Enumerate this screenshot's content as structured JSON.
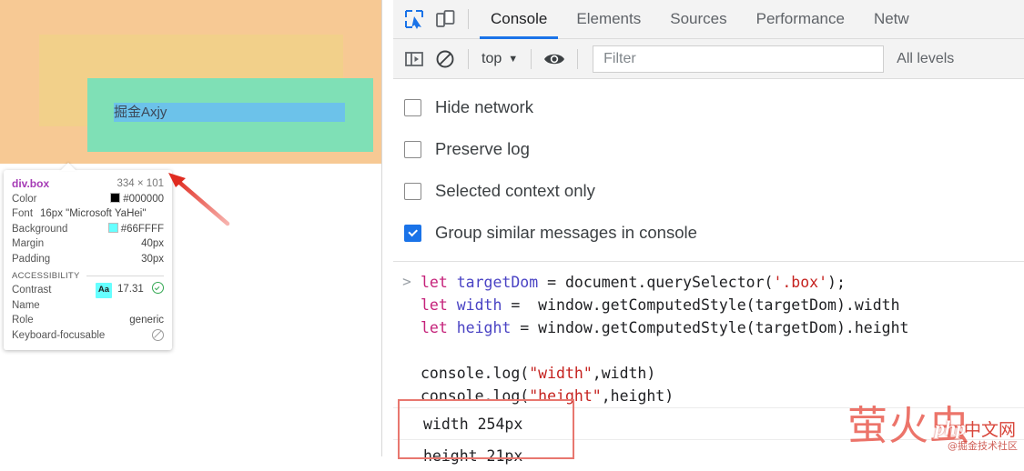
{
  "page": {
    "inline_text": "掘金Axjy",
    "colors": {
      "margin": "#f7c994",
      "padding": "#f2d08a",
      "content": "#7fe0b6",
      "inline": "#6cc2ea"
    }
  },
  "inspect_tooltip": {
    "selector": "div.box",
    "dimensions": "334 × 101",
    "rows": [
      {
        "label": "Color",
        "value": "#000000",
        "swatch": "#000000"
      },
      {
        "label": "Background",
        "value": "#66FFFF",
        "swatch": "#66FFFF"
      },
      {
        "label": "Margin",
        "value": "40px"
      },
      {
        "label": "Padding",
        "value": "30px"
      }
    ],
    "font_label": "Font",
    "font_value": "16px \"Microsoft YaHei\"",
    "color_label": "Color",
    "color_value": "#000000",
    "background_label": "Background",
    "background_value": "#66FFFF",
    "margin_label": "Margin",
    "margin_value": "40px",
    "padding_label": "Padding",
    "padding_value": "30px",
    "accessibility_header": "ACCESSIBILITY",
    "contrast_label": "Contrast",
    "contrast_chip": "Aa",
    "contrast_value": "17.31",
    "name_label": "Name",
    "name_value": "",
    "role_label": "Role",
    "role_value": "generic",
    "keyboard_label": "Keyboard-focusable",
    "keyboard_value": ""
  },
  "devtools": {
    "icons": {
      "inspect": "inspect-element-icon",
      "device": "device-toolbar-icon",
      "sidebar": "console-sidebar-icon",
      "clear": "clear-console-icon",
      "eye": "live-expression-icon"
    },
    "tabs": [
      {
        "label": "Console",
        "active": true
      },
      {
        "label": "Elements",
        "active": false
      },
      {
        "label": "Sources",
        "active": false
      },
      {
        "label": "Performance",
        "active": false
      },
      {
        "label": "Netw",
        "active": false
      }
    ],
    "toolbar": {
      "context": "top",
      "caret": "▼",
      "filter_placeholder": "Filter",
      "filter_value": "",
      "levels": "All levels"
    },
    "settings": [
      {
        "label": "Hide network",
        "checked": false
      },
      {
        "label": "Preserve log",
        "checked": false
      },
      {
        "label": "Selected context only",
        "checked": false
      },
      {
        "label": "Group similar messages in console",
        "checked": true
      }
    ],
    "console": {
      "prompt": ">",
      "code": [
        [
          {
            "t": "let ",
            "c": "kw"
          },
          {
            "t": "targetDom",
            "c": "var"
          },
          {
            "t": " = document.querySelector(",
            "c": "plain"
          },
          {
            "t": "'.box'",
            "c": "str"
          },
          {
            "t": ");",
            "c": "plain"
          }
        ],
        [
          {
            "t": "let ",
            "c": "kw"
          },
          {
            "t": "width",
            "c": "var"
          },
          {
            "t": " =  window.getComputedStyle(targetDom).width",
            "c": "plain"
          }
        ],
        [
          {
            "t": "let ",
            "c": "kw"
          },
          {
            "t": "height",
            "c": "var"
          },
          {
            "t": " = window.getComputedStyle(targetDom).height",
            "c": "plain"
          }
        ],
        [
          {
            "t": " ",
            "c": "plain"
          }
        ],
        [
          {
            "t": "console.log(",
            "c": "plain"
          },
          {
            "t": "\"width\"",
            "c": "str"
          },
          {
            "t": ",width)",
            "c": "plain"
          }
        ],
        [
          {
            "t": "console.log(",
            "c": "plain"
          },
          {
            "t": "\"height\"",
            "c": "str"
          },
          {
            "t": ",height)",
            "c": "plain"
          }
        ]
      ],
      "outputs": [
        "width 254px",
        "height 21px"
      ]
    }
  },
  "watermark": {
    "main": "萤火虫",
    "php": "php",
    "zh": "中文网",
    "sub": "@掘金技术社区"
  }
}
